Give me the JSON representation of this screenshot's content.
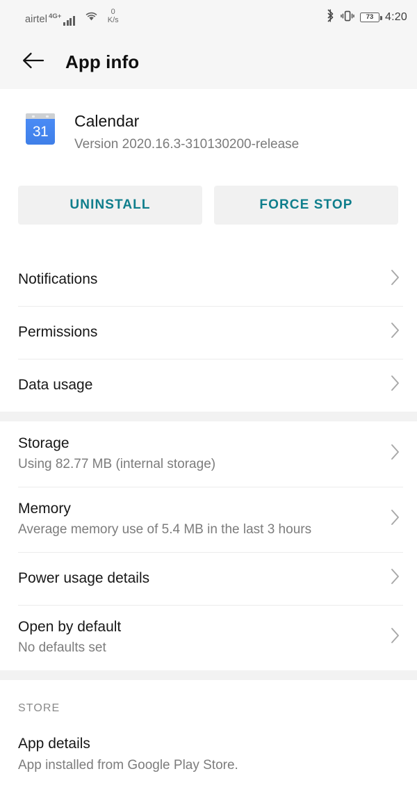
{
  "statusbar": {
    "carrier": "airtel",
    "network_type": "4G+",
    "signal_icon": "signal-bars-icon",
    "wifi_icon": "wifi-icon",
    "data_speed_value": "0",
    "data_speed_unit": "K/s",
    "bluetooth_icon": "bluetooth-icon",
    "vibrate_icon": "vibrate-icon",
    "battery_level": "73",
    "clock": "4:20"
  },
  "appbar": {
    "back_icon": "arrow-left-icon",
    "title": "App info"
  },
  "app": {
    "icon": "calendar-icon",
    "icon_day": "31",
    "name": "Calendar",
    "version": "Version 2020.16.3-310130200-release"
  },
  "actions": {
    "uninstall_label": "UNINSTALL",
    "force_stop_label": "FORCE STOP",
    "accent_color": "#0f7e8c"
  },
  "groups": [
    {
      "rows": [
        {
          "title": "Notifications",
          "subtitle": "",
          "chevron": "chevron-right-icon"
        },
        {
          "title": "Permissions",
          "subtitle": "",
          "chevron": "chevron-right-icon"
        },
        {
          "title": "Data usage",
          "subtitle": "",
          "chevron": "chevron-right-icon"
        }
      ]
    },
    {
      "rows": [
        {
          "title": "Storage",
          "subtitle": "Using 82.77 MB (internal storage)",
          "chevron": "chevron-right-icon"
        },
        {
          "title": "Memory",
          "subtitle": "Average memory use of 5.4 MB in the last 3 hours",
          "chevron": "chevron-right-icon"
        },
        {
          "title": "Power usage details",
          "subtitle": "",
          "chevron": "chevron-right-icon"
        },
        {
          "title": "Open by default",
          "subtitle": "No defaults set",
          "chevron": "chevron-right-icon"
        }
      ]
    }
  ],
  "store": {
    "section_label": "STORE",
    "title": "App details",
    "subtitle": "App installed from Google Play Store."
  }
}
